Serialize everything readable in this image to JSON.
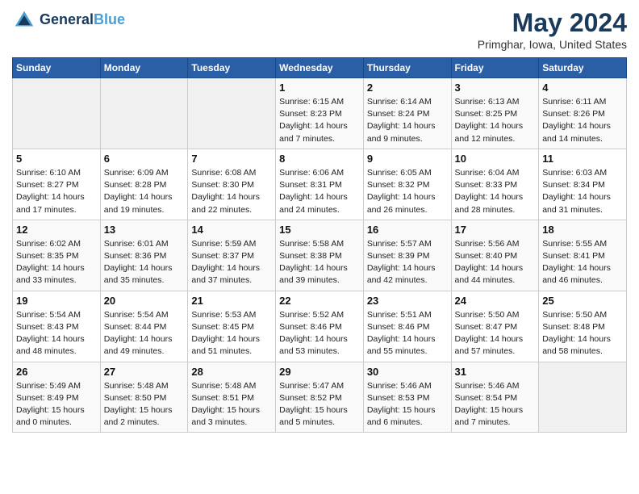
{
  "header": {
    "logo_line1": "General",
    "logo_line2": "Blue",
    "title": "May 2024",
    "subtitle": "Primghar, Iowa, United States"
  },
  "weekdays": [
    "Sunday",
    "Monday",
    "Tuesday",
    "Wednesday",
    "Thursday",
    "Friday",
    "Saturday"
  ],
  "weeks": [
    [
      {
        "day": "",
        "info": ""
      },
      {
        "day": "",
        "info": ""
      },
      {
        "day": "",
        "info": ""
      },
      {
        "day": "1",
        "info": "Sunrise: 6:15 AM\nSunset: 8:23 PM\nDaylight: 14 hours\nand 7 minutes."
      },
      {
        "day": "2",
        "info": "Sunrise: 6:14 AM\nSunset: 8:24 PM\nDaylight: 14 hours\nand 9 minutes."
      },
      {
        "day": "3",
        "info": "Sunrise: 6:13 AM\nSunset: 8:25 PM\nDaylight: 14 hours\nand 12 minutes."
      },
      {
        "day": "4",
        "info": "Sunrise: 6:11 AM\nSunset: 8:26 PM\nDaylight: 14 hours\nand 14 minutes."
      }
    ],
    [
      {
        "day": "5",
        "info": "Sunrise: 6:10 AM\nSunset: 8:27 PM\nDaylight: 14 hours\nand 17 minutes."
      },
      {
        "day": "6",
        "info": "Sunrise: 6:09 AM\nSunset: 8:28 PM\nDaylight: 14 hours\nand 19 minutes."
      },
      {
        "day": "7",
        "info": "Sunrise: 6:08 AM\nSunset: 8:30 PM\nDaylight: 14 hours\nand 22 minutes."
      },
      {
        "day": "8",
        "info": "Sunrise: 6:06 AM\nSunset: 8:31 PM\nDaylight: 14 hours\nand 24 minutes."
      },
      {
        "day": "9",
        "info": "Sunrise: 6:05 AM\nSunset: 8:32 PM\nDaylight: 14 hours\nand 26 minutes."
      },
      {
        "day": "10",
        "info": "Sunrise: 6:04 AM\nSunset: 8:33 PM\nDaylight: 14 hours\nand 28 minutes."
      },
      {
        "day": "11",
        "info": "Sunrise: 6:03 AM\nSunset: 8:34 PM\nDaylight: 14 hours\nand 31 minutes."
      }
    ],
    [
      {
        "day": "12",
        "info": "Sunrise: 6:02 AM\nSunset: 8:35 PM\nDaylight: 14 hours\nand 33 minutes."
      },
      {
        "day": "13",
        "info": "Sunrise: 6:01 AM\nSunset: 8:36 PM\nDaylight: 14 hours\nand 35 minutes."
      },
      {
        "day": "14",
        "info": "Sunrise: 5:59 AM\nSunset: 8:37 PM\nDaylight: 14 hours\nand 37 minutes."
      },
      {
        "day": "15",
        "info": "Sunrise: 5:58 AM\nSunset: 8:38 PM\nDaylight: 14 hours\nand 39 minutes."
      },
      {
        "day": "16",
        "info": "Sunrise: 5:57 AM\nSunset: 8:39 PM\nDaylight: 14 hours\nand 42 minutes."
      },
      {
        "day": "17",
        "info": "Sunrise: 5:56 AM\nSunset: 8:40 PM\nDaylight: 14 hours\nand 44 minutes."
      },
      {
        "day": "18",
        "info": "Sunrise: 5:55 AM\nSunset: 8:41 PM\nDaylight: 14 hours\nand 46 minutes."
      }
    ],
    [
      {
        "day": "19",
        "info": "Sunrise: 5:54 AM\nSunset: 8:43 PM\nDaylight: 14 hours\nand 48 minutes."
      },
      {
        "day": "20",
        "info": "Sunrise: 5:54 AM\nSunset: 8:44 PM\nDaylight: 14 hours\nand 49 minutes."
      },
      {
        "day": "21",
        "info": "Sunrise: 5:53 AM\nSunset: 8:45 PM\nDaylight: 14 hours\nand 51 minutes."
      },
      {
        "day": "22",
        "info": "Sunrise: 5:52 AM\nSunset: 8:46 PM\nDaylight: 14 hours\nand 53 minutes."
      },
      {
        "day": "23",
        "info": "Sunrise: 5:51 AM\nSunset: 8:46 PM\nDaylight: 14 hours\nand 55 minutes."
      },
      {
        "day": "24",
        "info": "Sunrise: 5:50 AM\nSunset: 8:47 PM\nDaylight: 14 hours\nand 57 minutes."
      },
      {
        "day": "25",
        "info": "Sunrise: 5:50 AM\nSunset: 8:48 PM\nDaylight: 14 hours\nand 58 minutes."
      }
    ],
    [
      {
        "day": "26",
        "info": "Sunrise: 5:49 AM\nSunset: 8:49 PM\nDaylight: 15 hours\nand 0 minutes."
      },
      {
        "day": "27",
        "info": "Sunrise: 5:48 AM\nSunset: 8:50 PM\nDaylight: 15 hours\nand 2 minutes."
      },
      {
        "day": "28",
        "info": "Sunrise: 5:48 AM\nSunset: 8:51 PM\nDaylight: 15 hours\nand 3 minutes."
      },
      {
        "day": "29",
        "info": "Sunrise: 5:47 AM\nSunset: 8:52 PM\nDaylight: 15 hours\nand 5 minutes."
      },
      {
        "day": "30",
        "info": "Sunrise: 5:46 AM\nSunset: 8:53 PM\nDaylight: 15 hours\nand 6 minutes."
      },
      {
        "day": "31",
        "info": "Sunrise: 5:46 AM\nSunset: 8:54 PM\nDaylight: 15 hours\nand 7 minutes."
      },
      {
        "day": "",
        "info": ""
      }
    ]
  ]
}
